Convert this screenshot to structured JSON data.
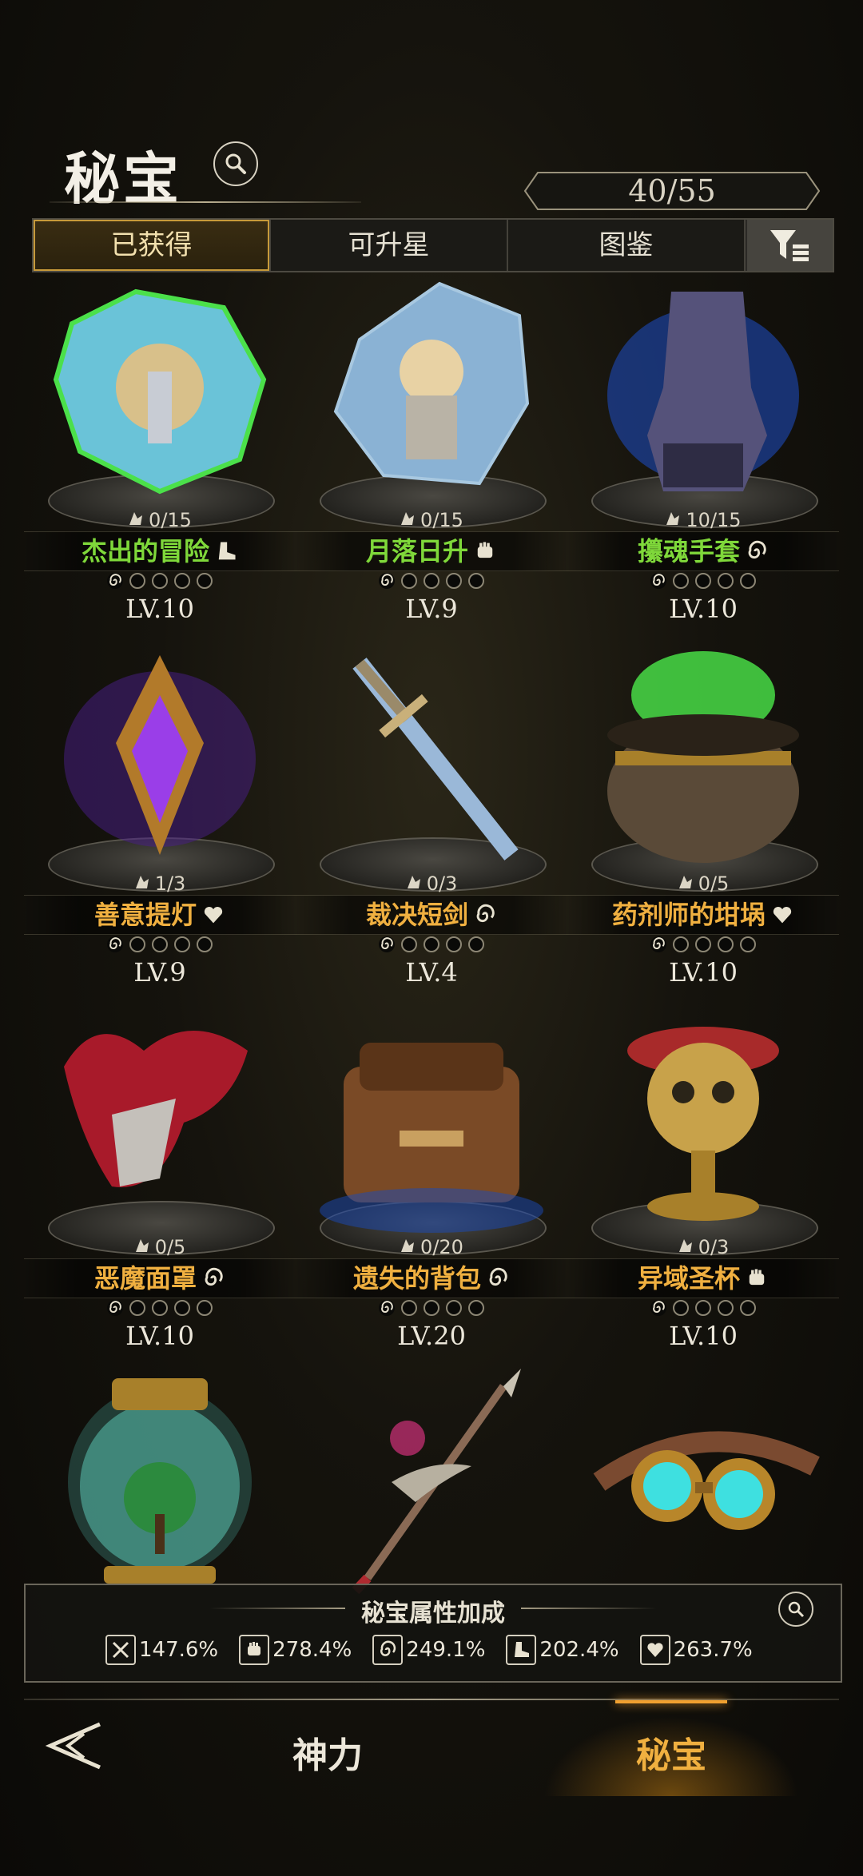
{
  "header": {
    "title": "秘宝",
    "counter": "40/55"
  },
  "tabs": [
    {
      "label": "已获得",
      "active": true
    },
    {
      "label": "可升星",
      "active": false
    },
    {
      "label": "图鉴",
      "active": false
    }
  ],
  "items": [
    {
      "name": "杰出的冒险",
      "progress": "0/15",
      "level": "LV.10",
      "color": "#7fd83a",
      "stars": 4,
      "art": "adventure-shard-icon",
      "type": "boot"
    },
    {
      "name": "月落日升",
      "progress": "0/15",
      "level": "LV.9",
      "color": "#7fd83a",
      "stars": 4,
      "art": "moon-sun-shard-icon",
      "type": "fist"
    },
    {
      "name": "攥魂手套",
      "progress": "10/15",
      "level": "LV.10",
      "color": "#7fd83a",
      "stars": 4,
      "art": "soul-gauntlet-icon",
      "type": "swirl"
    },
    {
      "name": "善意提灯",
      "progress": "1/3",
      "level": "LV.9",
      "color": "#f0b040",
      "stars": 5,
      "art": "kindness-lantern-icon",
      "type": "heart"
    },
    {
      "name": "裁决短剑",
      "progress": "0/3",
      "level": "LV.4",
      "color": "#f0b040",
      "stars": 5,
      "art": "verdict-dagger-icon",
      "type": "swirl"
    },
    {
      "name": "药剂师的坩埚",
      "progress": "0/5",
      "level": "LV.10",
      "color": "#f0b040",
      "stars": 4,
      "art": "cauldron-icon",
      "type": "heart"
    },
    {
      "name": "恶魔面罩",
      "progress": "0/5",
      "level": "LV.10",
      "color": "#f0b040",
      "stars": 5,
      "art": "demon-mask-icon",
      "type": "swirl"
    },
    {
      "name": "遗失的背包",
      "progress": "0/20",
      "level": "LV.20",
      "color": "#f0b040",
      "stars": 2,
      "art": "lost-backpack-icon",
      "type": "swirl"
    },
    {
      "name": "异域圣杯",
      "progress": "0/3",
      "level": "LV.10",
      "color": "#f0b040",
      "stars": 5,
      "art": "exotic-grail-icon",
      "type": "fist"
    }
  ],
  "row4_art": [
    "tree-jar-icon",
    "spear-icon",
    "goggles-icon"
  ],
  "attributes": {
    "title": "秘宝属性加成",
    "stats": [
      {
        "icon": "sword-icon",
        "value": "147.6%"
      },
      {
        "icon": "fist-icon",
        "value": "278.4%"
      },
      {
        "icon": "swirl-icon",
        "value": "249.1%"
      },
      {
        "icon": "boot-icon",
        "value": "202.4%"
      },
      {
        "icon": "heart-icon",
        "value": "263.7%"
      }
    ]
  },
  "nav": {
    "left": "神力",
    "right": "秘宝"
  }
}
